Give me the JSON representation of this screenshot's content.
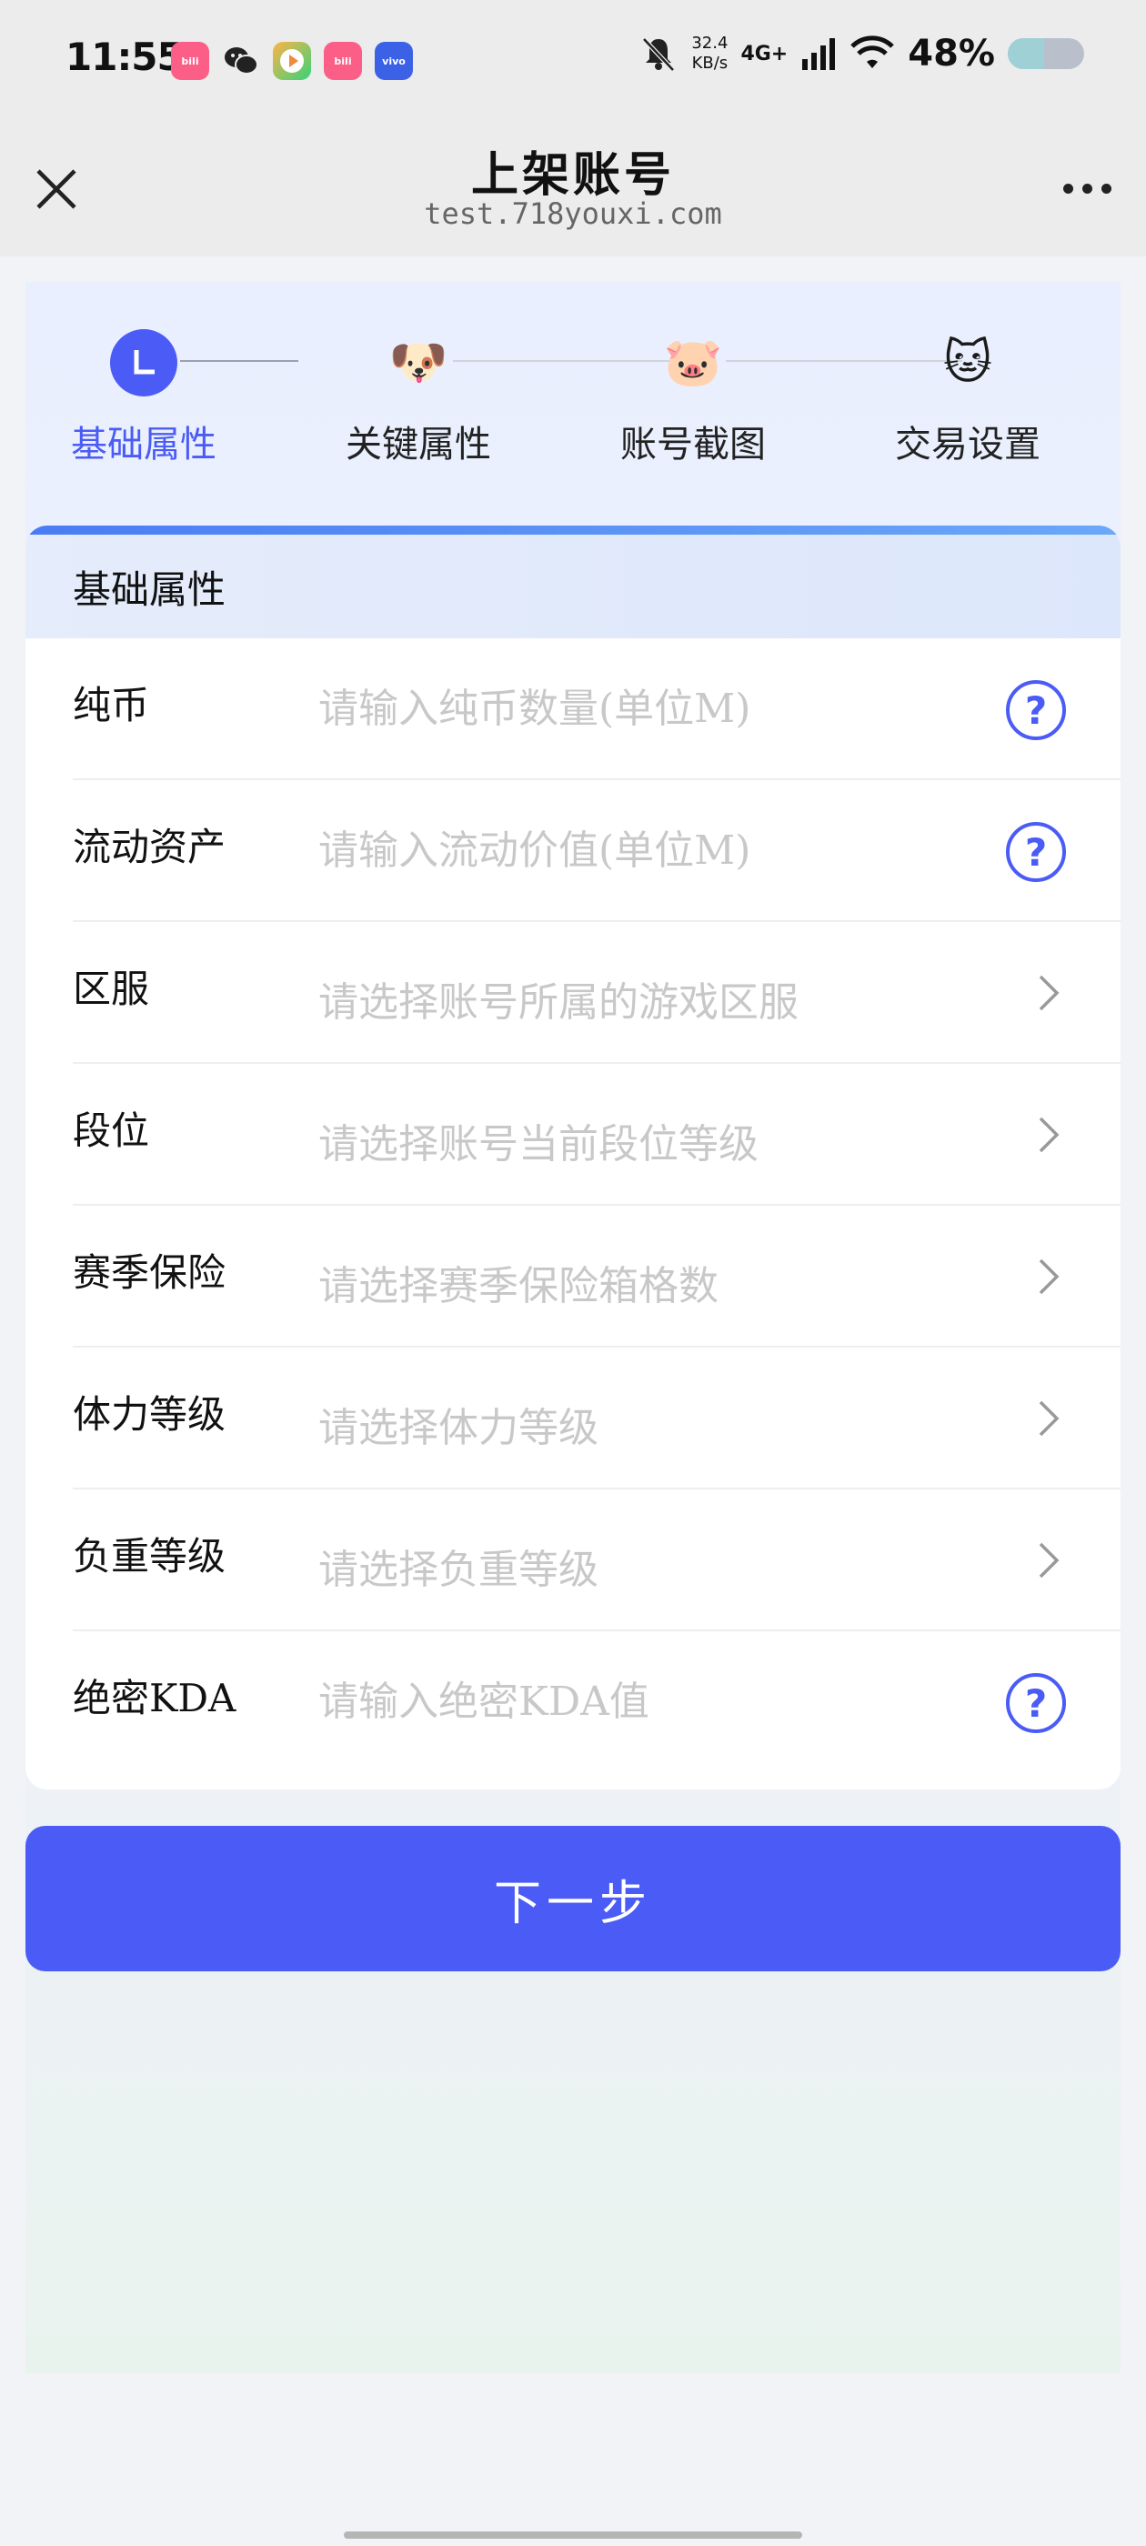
{
  "status_bar": {
    "time": "11:55",
    "apps": [
      {
        "name": "bilibili",
        "label": "bili"
      },
      {
        "name": "wechat",
        "label": ""
      },
      {
        "name": "video-player",
        "label": ""
      },
      {
        "name": "bilibili",
        "label": "bili"
      },
      {
        "name": "vivo",
        "label": "vivo"
      }
    ],
    "speed_value": "32.4",
    "speed_unit": "KB/s",
    "network": "4G+",
    "battery": "48%",
    "battery_level": 0.48
  },
  "nav": {
    "title": "上架账号",
    "url": "test.718youxi.com"
  },
  "steps": [
    {
      "label": "基础属性",
      "icon": "L",
      "active": true
    },
    {
      "label": "关键属性",
      "icon": "🐶",
      "active": false
    },
    {
      "label": "账号截图",
      "icon": "🐷",
      "active": false
    },
    {
      "label": "交易设置",
      "icon": "🐱",
      "active": false
    }
  ],
  "card": {
    "title": "基础属性",
    "rows": [
      {
        "label": "纯币",
        "placeholder": "请输入纯币数量(单位M)",
        "type": "input",
        "icon": "help-icon"
      },
      {
        "label": "流动资产",
        "placeholder": "请输入流动价值(单位M)",
        "type": "input",
        "icon": "help-icon"
      },
      {
        "label": "区服",
        "placeholder": "请选择账号所属的游戏区服",
        "type": "select",
        "icon": "chevron-right-icon"
      },
      {
        "label": "段位",
        "placeholder": "请选择账号当前段位等级",
        "type": "select",
        "icon": "chevron-right-icon"
      },
      {
        "label": "赛季保险",
        "placeholder": "请选择赛季保险箱格数",
        "type": "select",
        "icon": "chevron-right-icon"
      },
      {
        "label": "体力等级",
        "placeholder": "请选择体力等级",
        "type": "select",
        "icon": "chevron-right-icon"
      },
      {
        "label": "负重等级",
        "placeholder": "请选择负重等级",
        "type": "select",
        "icon": "chevron-right-icon"
      },
      {
        "label": "绝密KDA",
        "placeholder": "请输入绝密KDA值",
        "type": "input",
        "icon": "help-icon"
      }
    ]
  },
  "next_button": "下一步",
  "colors": {
    "accent": "#4a5cf5",
    "placeholder": "#c8c8c8"
  }
}
